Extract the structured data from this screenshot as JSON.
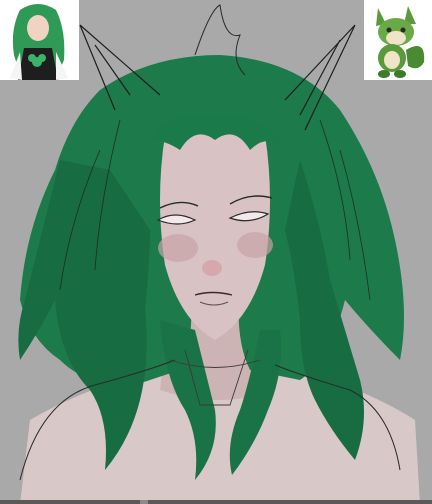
{
  "app": {
    "name": ""
  },
  "canvas": {
    "background": "#a9a9a9",
    "layers": [
      {
        "name": "sketch-lines",
        "color": "#1e1e1e"
      },
      {
        "name": "hair-color",
        "color": "#1a7a4a"
      },
      {
        "name": "skin-base",
        "color": "#d8c3c3"
      }
    ]
  },
  "references": [
    {
      "name": "character-reference",
      "background": "#ffffff"
    },
    {
      "name": "creature-reference",
      "background": "#ffffff"
    }
  ],
  "icons": {
    "scrollbar": "scrollbar-handle"
  }
}
